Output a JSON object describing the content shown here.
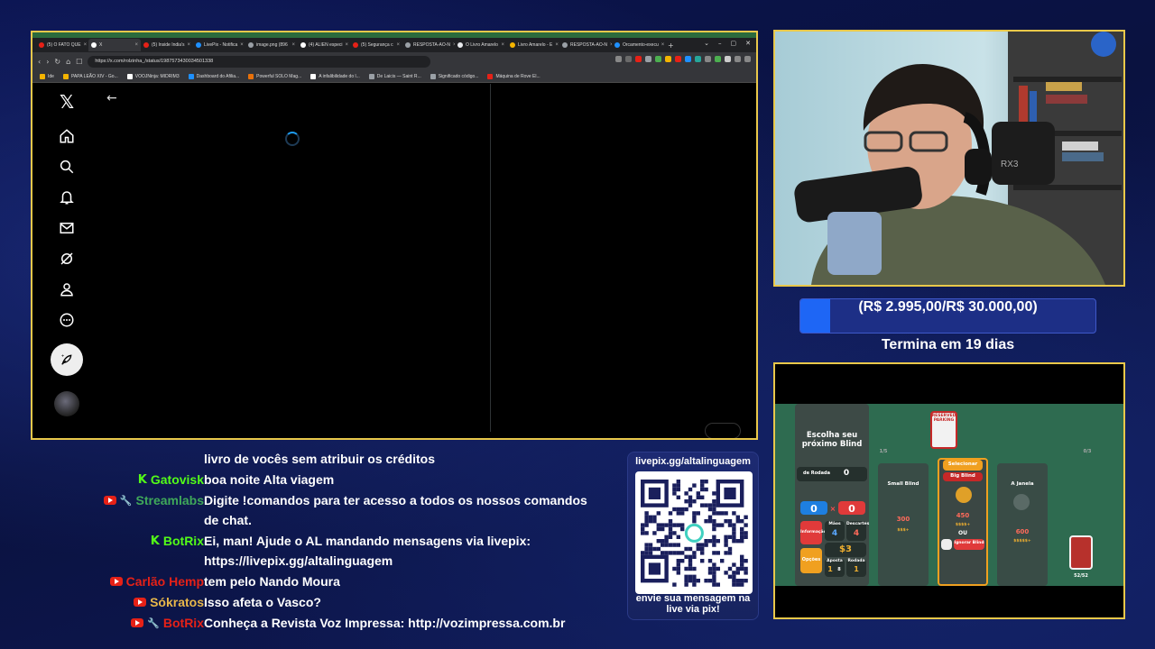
{
  "browser": {
    "tabs": [
      {
        "label": "(5) O FATO QUE",
        "color": "#e62117"
      },
      {
        "label": "X",
        "color": "#ffffff",
        "active": true
      },
      {
        "label": "(5) Inside India's",
        "color": "#e62117"
      },
      {
        "label": "LivePix - Notifica",
        "color": "#1e90ff"
      },
      {
        "label": "image.png (896",
        "color": "#9aa0a6"
      },
      {
        "label": "(4) ALIEN especi",
        "color": "#ffffff"
      },
      {
        "label": "(5) Segurança c",
        "color": "#e62117"
      },
      {
        "label": "RESPOSTA-AO-N",
        "color": "#9aa0a6"
      },
      {
        "label": "O Livro Amarelo",
        "color": "#e8eaed"
      },
      {
        "label": "Livro Amarelo - E",
        "color": "#f4b400"
      },
      {
        "label": "RESPOSTA-AO-N",
        "color": "#9aa0a6"
      },
      {
        "label": "Orcamento-execu",
        "color": "#1e90ff"
      }
    ],
    "new_tab": "+",
    "window_controls": [
      "⌄",
      "–",
      "▢",
      "✕"
    ],
    "url": "https://x.com/rolzinha_/status/1987573430034501338",
    "bookmarks": [
      {
        "label": "Ide",
        "color": "#f4b400"
      },
      {
        "label": "PAPA LEÃO XIV - Go...",
        "color": "#f4b400"
      },
      {
        "label": "VOOJNinja: MIDRIM3",
        "color": "#ffffff"
      },
      {
        "label": "Dashboard do Afilia...",
        "color": "#1e90ff"
      },
      {
        "label": "Powerful SOLO Mag...",
        "color": "#e8710a"
      },
      {
        "label": "A infalibilidade do l...",
        "color": "#ffffff"
      },
      {
        "label": "De Laicis — Saint R...",
        "color": "#9aa0a6"
      },
      {
        "label": "Significado código...",
        "color": "#9aa0a6"
      },
      {
        "label": "Máquina de Rove El...",
        "color": "#e62117"
      }
    ]
  },
  "x_app": {
    "logo": "𝕏",
    "nav_icons": [
      "home-icon",
      "search-icon",
      "notifications-icon",
      "messages-icon",
      "grok-icon",
      "profile-icon",
      "more-icon"
    ],
    "back_arrow": "←"
  },
  "chat": [
    {
      "user": "",
      "user_color": "#ffffff",
      "badges": [],
      "text": "livro de vocês sem atribuir os créditos"
    },
    {
      "user": "Gatovisk",
      "user_color": "#53fc18",
      "badges": [
        "kick"
      ],
      "text": "boa noite Alta viagem"
    },
    {
      "user": "Streamlabs",
      "user_color": "#3fa85a",
      "badges": [
        "youtube",
        "wrench"
      ],
      "text": "Digite !comandos para ter acesso a todos os nossos comandos de chat."
    },
    {
      "user": "BotRix",
      "user_color": "#53fc18",
      "badges": [
        "kick"
      ],
      "text": "Ei, man! Ajude o AL mandando mensagens via livepix: https://livepix.gg/altalinguagem"
    },
    {
      "user": "Carlão Hemp",
      "user_color": "#e62117",
      "badges": [
        "youtube"
      ],
      "text": "tem pelo Nando Moura"
    },
    {
      "user": "Sókratos",
      "user_color": "#e9b84a",
      "badges": [
        "youtube"
      ],
      "text": "Isso afeta o Vasco?"
    },
    {
      "user": "BotRix",
      "user_color": "#e62117",
      "badges": [
        "youtube",
        "wrench"
      ],
      "text": "Conheça a Revista Voz Impressa: http://vozimpressa.com.br"
    }
  ],
  "qr": {
    "link": "livepix.gg/altalinguagem",
    "caption": "envie sua mensagem na live via pix!"
  },
  "goal": {
    "label": "(R$ 2.995,00/R$ 30.000,00)",
    "progress": 0.0998,
    "deadline": "Termina em 19 dias",
    "fill_color": "#1e66f5"
  },
  "game": {
    "choose_title": "Escolha seu próximo Blind",
    "small_blind": "Small Blind",
    "big_blind": "Big Blind",
    "boss_blind": "A Janela",
    "select_label": "Selecionar",
    "skip_label": "Ignorar Blind",
    "or_label": "OU",
    "hands_label": "Mãos",
    "discards_label": "Descartes",
    "hands_value": "4",
    "discards_value": "4",
    "score_left": "0",
    "score_right": "0",
    "money": "$3",
    "ante_label": "Aposta",
    "ante_value": "1",
    "ante_max": "8",
    "round_label": "Rodada",
    "round_value": "1",
    "options_label": "Opções",
    "round_score_label": "de Rodada",
    "round_score_value": "0",
    "run_info": "Informação",
    "big_target": "450",
    "small_target": "300",
    "boss_target": "600",
    "reward_small": "$$$+",
    "reward_big": "$$$$+",
    "reward_boss": "$$$$$+",
    "deck_count": "52/52",
    "tag_text": "RESERVED PARKING",
    "counter_small": "1/5",
    "counter_big": "0/3"
  }
}
